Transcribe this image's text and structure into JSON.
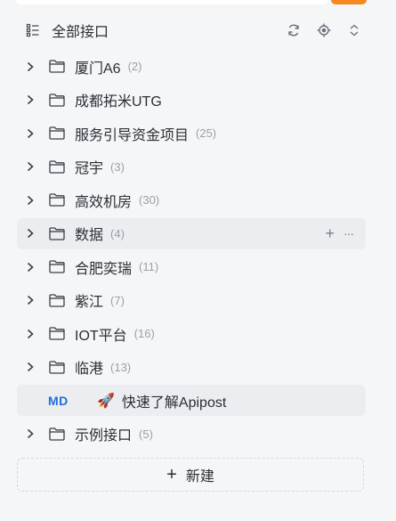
{
  "header": {
    "title": "全部接口",
    "icons": [
      "tree-list-icon",
      "refresh-icon",
      "locate-icon",
      "expand-collapse-icon"
    ]
  },
  "tree": {
    "items": [
      {
        "type": "folder",
        "label": "厦门A6",
        "count": "(2)"
      },
      {
        "type": "folder",
        "label": "成都拓米UTG",
        "count": ""
      },
      {
        "type": "folder",
        "label": "服务引导资金项目",
        "count": "(25)"
      },
      {
        "type": "folder",
        "label": "冠宇",
        "count": "(3)"
      },
      {
        "type": "folder",
        "label": "高效机房",
        "count": "(30)"
      },
      {
        "type": "folder",
        "label": "数据",
        "count": "(4)",
        "hovered": true
      },
      {
        "type": "folder",
        "label": "合肥奕瑞",
        "count": "(11)"
      },
      {
        "type": "folder",
        "label": "紫江",
        "count": "(7)"
      },
      {
        "type": "folder",
        "label": "IOT平台",
        "count": "(16)"
      },
      {
        "type": "folder",
        "label": "临港",
        "count": "(13)"
      },
      {
        "type": "doc",
        "badge": "MD",
        "label": "快速了解Apipost",
        "emoji": "🚀"
      },
      {
        "type": "folder",
        "label": "示例接口",
        "count": "(5)"
      }
    ],
    "row_actions": {
      "add": "+",
      "more": "···"
    }
  },
  "new_button": {
    "plus": "+",
    "label": "新建"
  },
  "colors": {
    "accent": "#f5891f",
    "md_badge": "#1f6fd6",
    "hover_bg": "#ebedf0"
  }
}
